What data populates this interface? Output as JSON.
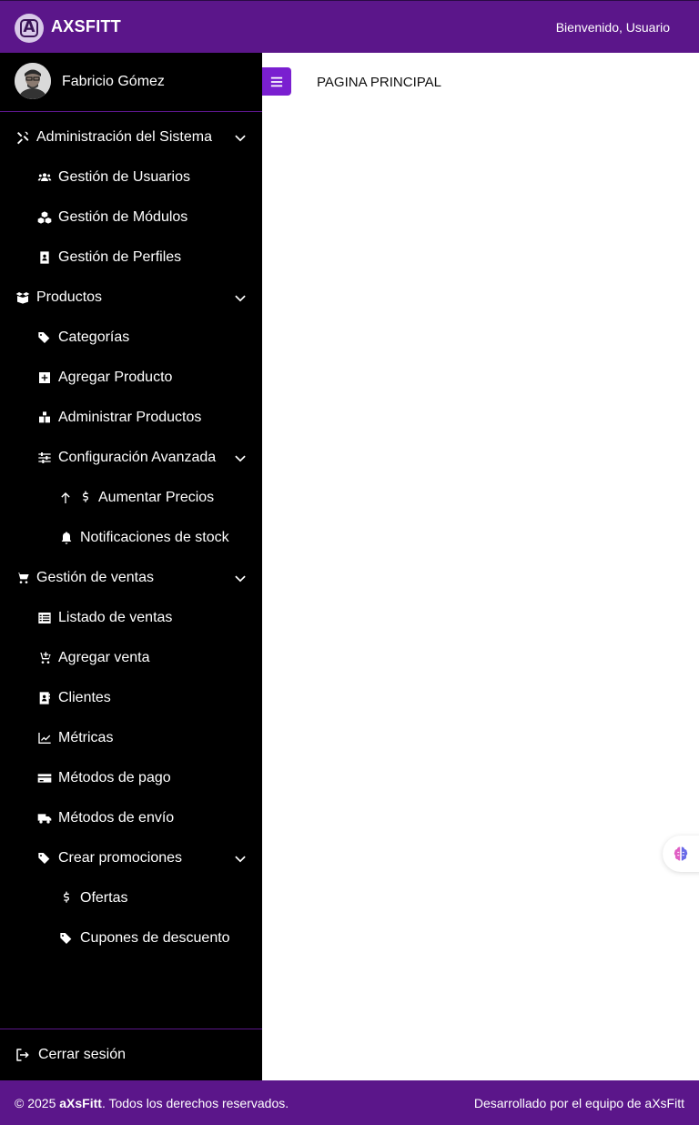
{
  "header": {
    "logo_letter": "A",
    "brand": "AXSFITT",
    "welcome": "Bienvenido, Usuario"
  },
  "profile": {
    "name": "Fabricio Gómez"
  },
  "menu": [
    {
      "label": "Administración del Sistema",
      "icon": "tools-icon",
      "level": 0,
      "expandable": true
    },
    {
      "label": "Gestión de Usuarios",
      "icon": "users-icon",
      "level": 1
    },
    {
      "label": "Gestión de Módulos",
      "icon": "cubes-icon",
      "level": 1
    },
    {
      "label": "Gestión de Perfiles",
      "icon": "id-badge-icon",
      "level": 1
    },
    {
      "label": "Productos",
      "icon": "box-open-icon",
      "level": 0,
      "expandable": true
    },
    {
      "label": "Categorías",
      "icon": "tags-icon",
      "level": 1
    },
    {
      "label": "Agregar Producto",
      "icon": "plus-square-icon",
      "level": 1
    },
    {
      "label": "Administrar Productos",
      "icon": "boxes-icon",
      "level": 1
    },
    {
      "label": "Configuración Avanzada",
      "icon": "sliders-icon",
      "level": 1,
      "expandable": true
    },
    {
      "label": "Aumentar Precios",
      "icon": "arrow-up-dollar-icon",
      "level": 2
    },
    {
      "label": "Notificaciones de stock",
      "icon": "bell-icon",
      "level": 2
    },
    {
      "label": "Gestión de ventas",
      "icon": "cart-icon",
      "level": 0,
      "expandable": true
    },
    {
      "label": "Listado de ventas",
      "icon": "list-icon",
      "level": 1
    },
    {
      "label": "Agregar venta",
      "icon": "cart-plus-icon",
      "level": 1
    },
    {
      "label": "Clientes",
      "icon": "address-book-icon",
      "level": 1
    },
    {
      "label": "Métricas",
      "icon": "chart-line-icon",
      "level": 1
    },
    {
      "label": "Métodos de pago",
      "icon": "credit-card-icon",
      "level": 1
    },
    {
      "label": "Métodos de envío",
      "icon": "truck-icon",
      "level": 1
    },
    {
      "label": "Crear promociones",
      "icon": "tags-icon",
      "level": 1,
      "expandable": true
    },
    {
      "label": "Ofertas",
      "icon": "dollar-icon",
      "level": 2
    },
    {
      "label": "Cupones de descuento",
      "icon": "tags-icon",
      "level": 2
    }
  ],
  "logout": {
    "label": "Cerrar sesión"
  },
  "main": {
    "title": "PAGINA PRINCIPAL"
  },
  "footer": {
    "copyright_prefix": "© 2025 ",
    "brand": "aXsFitt",
    "copyright_suffix": ". Todos los derechos reservados.",
    "credits": "Desarrollado por el equipo de aXsFitt"
  },
  "colors": {
    "header_bg": "#5b168a",
    "sidebar_bg": "#000000",
    "toggle_bg": "#7a1fd0"
  }
}
